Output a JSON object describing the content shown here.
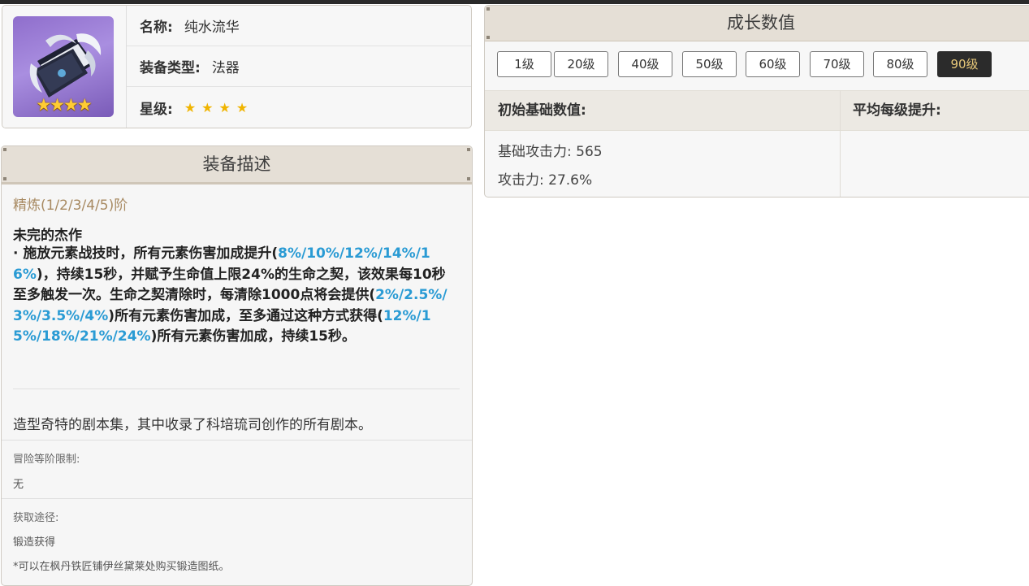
{
  "item": {
    "rarity_stars": "★★★★",
    "name_label": "名称:",
    "name_value": "纯水流华",
    "type_label": "装备类型:",
    "type_value": "法器",
    "stars_label": "星级:",
    "stars_value": "★★★★",
    "star_color": "#f0b400"
  },
  "description": {
    "header": "装备描述",
    "refinement": "精炼(1/2/3/4/5)阶",
    "skill_name": "未完的杰作",
    "skill_parts": [
      {
        "text": "· 施放元素战技时，所有元素伤害加成提升(",
        "hl": false
      },
      {
        "text": "8%/10%/12%/14%/16%",
        "hl": true
      },
      {
        "text": ")，持续15秒，并赋予生命值上限24%的生命之契，该效果每10秒至多触发一次。生命之契清除时，每清除1000点将会提供(",
        "hl": false
      },
      {
        "text": "2%/2.5%/3%/3.5%/4%",
        "hl": true
      },
      {
        "text": ")所有元素伤害加成，至多通过这种方式获得(",
        "hl": false
      },
      {
        "text": "12%/15%/18%/21%/24%",
        "hl": true
      },
      {
        "text": ")所有元素伤害加成，持续15秒。",
        "hl": false
      }
    ],
    "highlight_color": "#2a9bd4",
    "flavor_text": "造型奇特的剧本集，其中收录了科培琉司创作的所有剧本。",
    "ascension_label": "冒险等阶限制:",
    "ascension_value": "无",
    "source_label": "获取途径:",
    "source_value": "锻造获得",
    "source_note": "*可以在枫丹铁匠铺伊丝黛莱处购买锻造图纸。"
  },
  "growth": {
    "header": "成长数值",
    "levels": [
      "1级",
      "20级",
      "40级",
      "50级",
      "60级",
      "70级",
      "80级",
      "90级"
    ],
    "active_level": "90级",
    "base_header": "初始基础数值:",
    "avg_header": "平均每级提升:",
    "stats": [
      "基础攻击力: 565",
      "攻击力: 27.6%"
    ]
  }
}
